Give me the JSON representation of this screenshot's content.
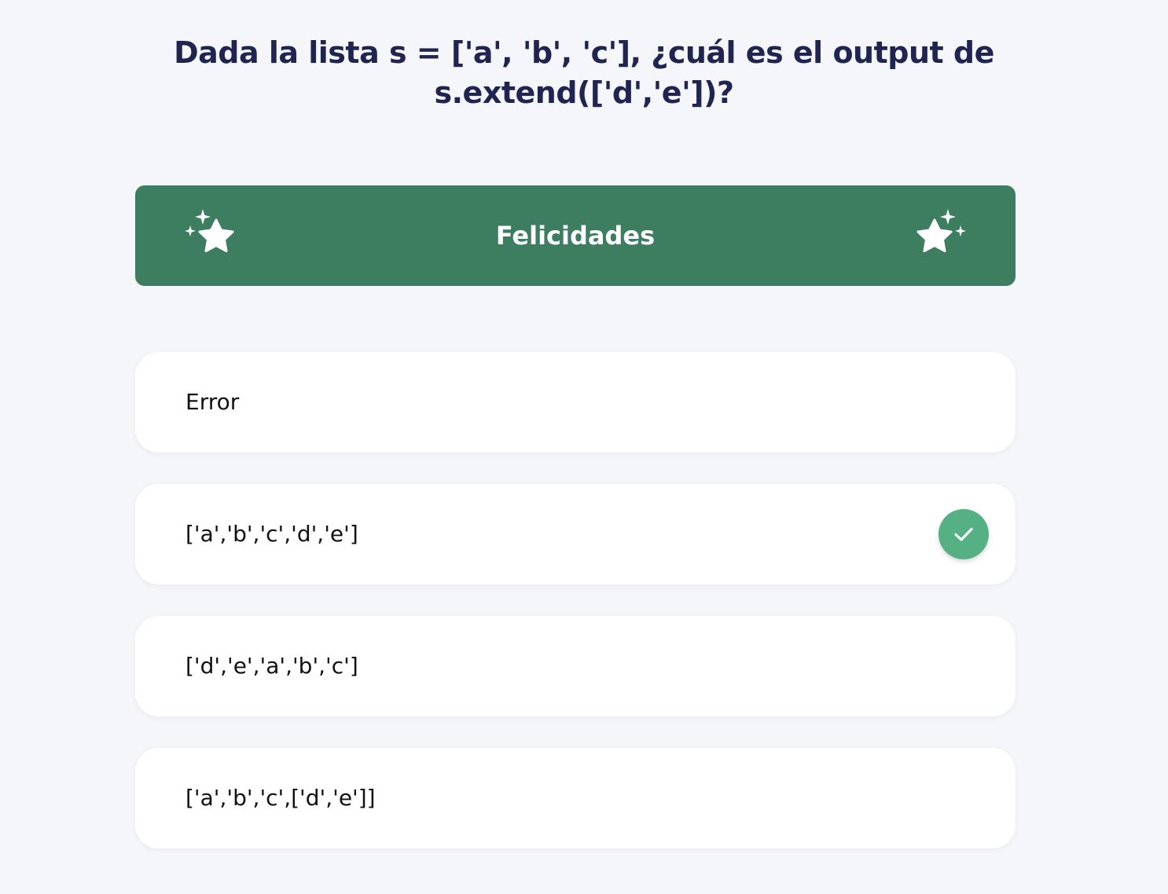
{
  "question": {
    "text": "Dada la lista s = ['a', 'b', 'c'], ¿cuál es el output de s.extend(['d','e'])?"
  },
  "feedback_banner": {
    "title": "Felicidades",
    "color": "#3e7e60",
    "icon": "sparkle-star-icon"
  },
  "options": [
    {
      "label": "Error",
      "correct": false
    },
    {
      "label": "['a','b','c','d','e']",
      "correct": true
    },
    {
      "label": "['d','e','a','b','c']",
      "correct": false
    },
    {
      "label": "['a','b','c',['d','e']]",
      "correct": false
    }
  ],
  "colors": {
    "background": "#f5f6fa",
    "question_text": "#1f2550",
    "correct_badge": "#55b083"
  }
}
